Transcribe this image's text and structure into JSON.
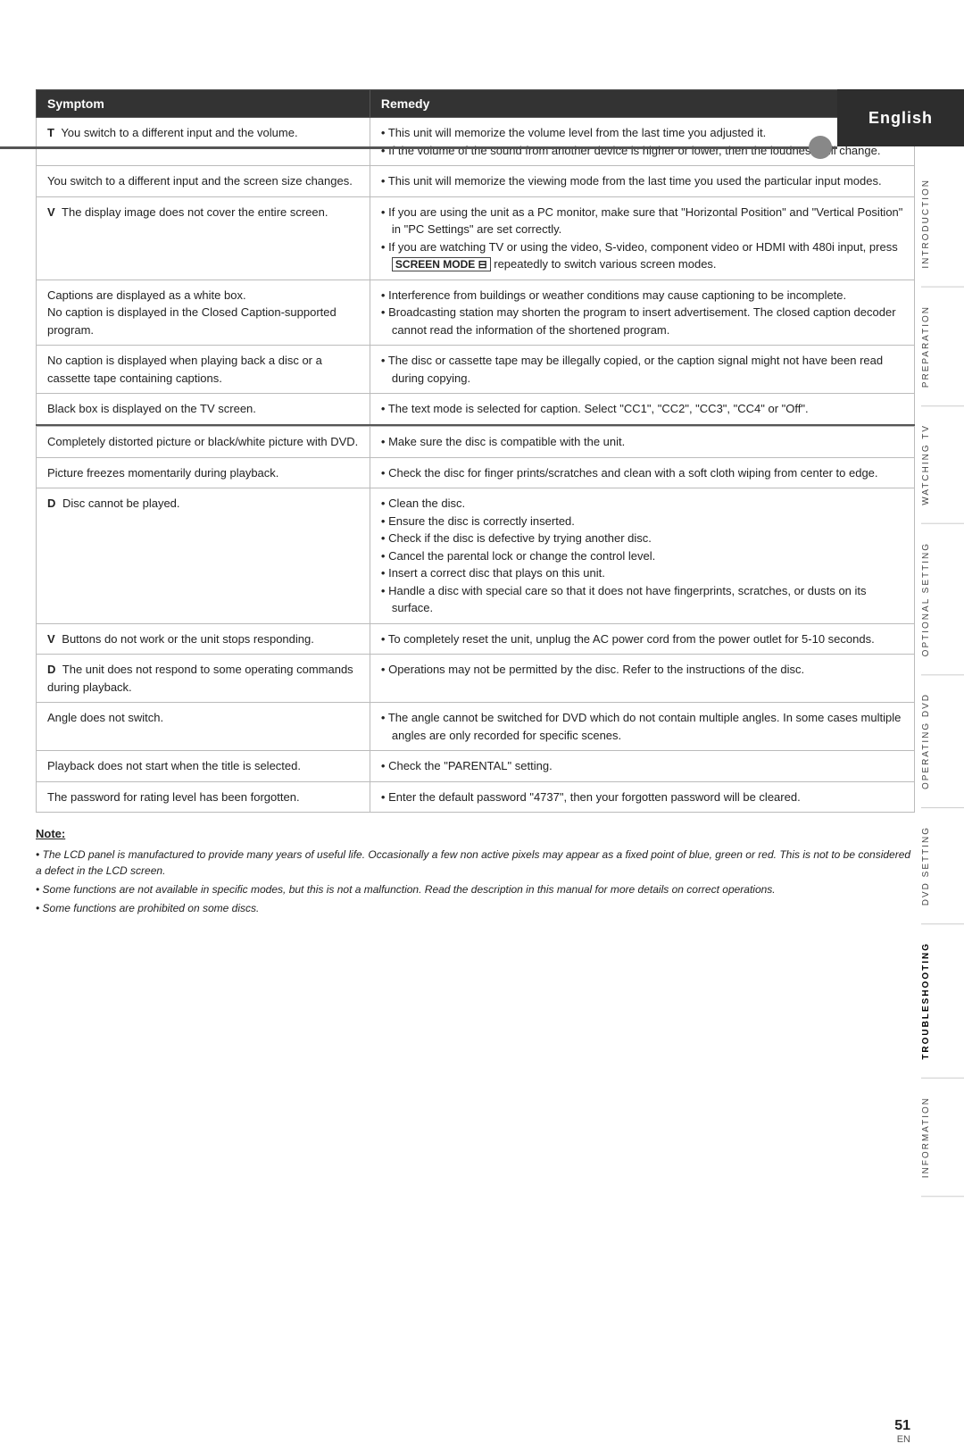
{
  "header": {
    "language": "English"
  },
  "sidebar_sections": [
    "INTRODUCTION",
    "PREPARATION",
    "WATCHING TV",
    "OPTIONAL SETTING",
    "OPERATING DVD",
    "DVD SETTING",
    "TROUBLESHOOTING",
    "INFORMATION"
  ],
  "table": {
    "col_symptom": "Symptom",
    "col_remedy": "Remedy",
    "rows": [
      {
        "marker": "T",
        "symptom": "You switch to a different input and the volume.",
        "remedy_lines": [
          "• This unit will memorize the volume level from the last time you adjusted it.",
          "• If the volume of the sound from another device is higher or lower, then the loudness will change."
        ],
        "section_break": false
      },
      {
        "marker": "",
        "symptom": "You switch to a different input and the screen size changes.",
        "remedy_lines": [
          "• This unit will memorize the viewing mode from the last time you used the particular input modes."
        ],
        "section_break": false
      },
      {
        "marker": "V",
        "symptom": "The display image does not cover the entire screen.",
        "remedy_lines": [
          "• If you are using the unit as a PC monitor, make sure that \"Horizontal Position\" and \"Vertical Position\" in \"PC Settings\" are set correctly.",
          "• If you are watching TV or using the video, S-video, component video or HDMI with 480i input, press [SCREEN MODE ⊟] repeatedly to switch various screen modes."
        ],
        "section_break": false
      },
      {
        "marker": "",
        "symptom": "Captions are displayed as a white box.\nNo caption is displayed in the Closed Caption-supported program.",
        "remedy_lines": [
          "• Interference from buildings or weather conditions may cause captioning to be incomplete.",
          "• Broadcasting station may shorten the program to insert advertisement. The closed caption decoder cannot read the information of the shortened program."
        ],
        "section_break": false
      },
      {
        "marker": "",
        "symptom": "No caption is displayed when playing back a disc or a cassette tape containing captions.",
        "remedy_lines": [
          "• The disc or cassette tape may be illegally copied, or the caption signal might not have been read during copying."
        ],
        "section_break": false
      },
      {
        "marker": "",
        "symptom": "Black box is displayed on the TV screen.",
        "remedy_lines": [
          "• The text mode is selected for caption. Select \"CC1\", \"CC2\", \"CC3\", \"CC4\" or \"Off\"."
        ],
        "section_break": true
      },
      {
        "marker": "",
        "symptom": "Completely distorted picture or black/white picture with DVD.",
        "remedy_lines": [
          "• Make sure the disc is compatible with the unit."
        ],
        "section_break": false
      },
      {
        "marker": "",
        "symptom": "Picture freezes momentarily during playback.",
        "remedy_lines": [
          "• Check the disc for finger prints/scratches and clean with a soft cloth wiping from center to edge."
        ],
        "section_break": false
      },
      {
        "marker": "D",
        "symptom": "Disc cannot be played.",
        "remedy_lines": [
          "• Clean the disc.",
          "• Ensure the disc is correctly inserted.",
          "• Check if the disc is defective by trying another disc.",
          "• Cancel the parental lock or change the control level.",
          "• Insert a correct disc that plays on this unit.",
          "• Handle a disc with special care so that it does not have fingerprints, scratches, or dusts on its surface."
        ],
        "section_break": false
      },
      {
        "marker": "V",
        "symptom": "Buttons do not work or the unit stops responding.",
        "remedy_lines": [
          "• To completely reset the unit, unplug the AC power cord from the power outlet for 5-10 seconds."
        ],
        "section_break": false
      },
      {
        "marker": "D",
        "symptom": "The unit does not respond to some operating commands during playback.",
        "remedy_lines": [
          "• Operations may not be permitted by the disc. Refer to the instructions of the disc."
        ],
        "section_break": false
      },
      {
        "marker": "",
        "symptom": "Angle does not switch.",
        "remedy_lines": [
          "• The angle cannot be switched for DVD which do not contain multiple angles. In some cases multiple angles are only recorded for specific scenes."
        ],
        "section_break": false
      },
      {
        "marker": "",
        "symptom": "Playback does not start when the title is selected.",
        "remedy_lines": [
          "• Check the \"PARENTAL\" setting."
        ],
        "section_break": false
      },
      {
        "marker": "",
        "symptom": "The password for rating level has been forgotten.",
        "remedy_lines": [
          "• Enter the default password \"4737\", then your forgotten password will be cleared."
        ],
        "section_break": false
      }
    ]
  },
  "note": {
    "title": "Note:",
    "items": [
      "The LCD panel is manufactured to provide many years of useful life. Occasionally a few non active pixels may appear as a fixed point of blue, green or red. This is not to be considered a defect in the LCD screen.",
      "Some functions are not available in specific modes, but this is not a malfunction. Read the description in this manual  for more details on correct operations.",
      "Some functions are prohibited on some discs."
    ]
  },
  "page_number": "51",
  "page_lang": "EN"
}
